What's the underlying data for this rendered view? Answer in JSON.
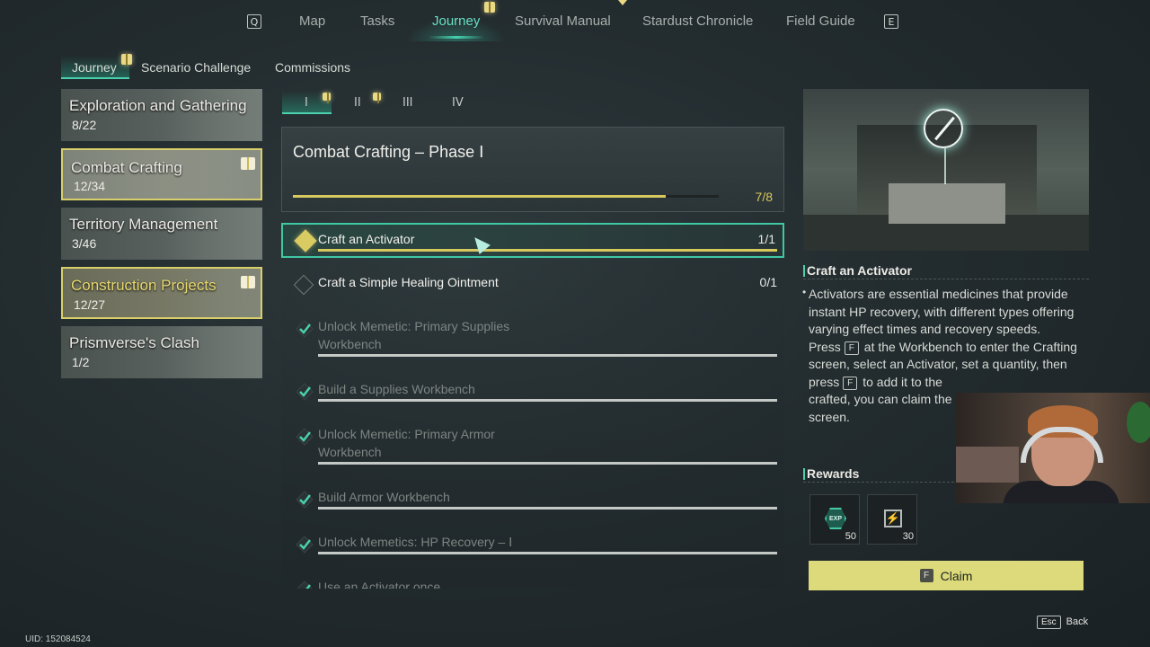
{
  "nav": {
    "left_key": "Q",
    "right_key": "E",
    "tabs": [
      "Map",
      "Tasks",
      "Journey",
      "Survival Manual",
      "Stardust Chronicle",
      "Field Guide"
    ],
    "active_tab": "Journey"
  },
  "subtabs": [
    "Journey",
    "Scenario Challenge",
    "Commissions"
  ],
  "categories": [
    {
      "title": "Exploration and Gathering",
      "count": "8/22"
    },
    {
      "title": "Combat Crafting",
      "count": "12/34"
    },
    {
      "title": "Territory Management",
      "count": "3/46"
    },
    {
      "title": "Construction Projects",
      "count": "12/27"
    },
    {
      "title": "Prismverse's Clash",
      "count": "1/2"
    }
  ],
  "phase_tabs": [
    "I",
    "II",
    "III",
    "IV"
  ],
  "phase": {
    "title": "Combat Crafting – Phase Ⅰ",
    "progress_text": "7/8",
    "progress_fraction": 0.875
  },
  "tasks": [
    {
      "label": "Craft an Activator",
      "count": "1/1",
      "status": "claimable",
      "progress": 1.0
    },
    {
      "label": "Craft a Simple Healing Ointment",
      "count": "0/1",
      "status": "in-progress",
      "progress": 0
    },
    {
      "label": "Unlock Memetic: Primary Supplies Workbench",
      "status": "done",
      "line1": "Unlock Memetic: Primary Supplies",
      "line2": "Workbench"
    },
    {
      "label": "Build a Supplies Workbench",
      "status": "done"
    },
    {
      "label": "Unlock Memetic: Primary Armor Workbench",
      "status": "done",
      "line1": "Unlock Memetic: Primary Armor",
      "line2": "Workbench"
    },
    {
      "label": "Build Armor Workbench",
      "status": "done"
    },
    {
      "label": "Unlock Memetics: HP Recovery – Ⅰ",
      "status": "done"
    },
    {
      "label": "Use an Activator once",
      "status": "done"
    }
  ],
  "detail": {
    "title": "Craft an Activator",
    "desc1": "Activators are essential medicines that provide instant HP recovery, with different types offering varying effect times and recovery speeds.",
    "desc2a": "Press",
    "key": "F",
    "desc2b": "at the Workbench to enter the Crafting screen, select an Activator, set a quantity, then press",
    "desc2c": "to add it to the",
    "desc2d": "crafted, you can claim the",
    "desc2e": "screen.",
    "rewards_heading": "Rewards",
    "rewards": [
      {
        "icon": "exp-icon",
        "icon_text": "EXP",
        "amount": "50"
      },
      {
        "icon": "energy-icon",
        "amount": "30"
      }
    ],
    "claim_key": "F",
    "claim_label": "Claim"
  },
  "footer": {
    "uid": "UID: 152084524",
    "esc_key": "Esc",
    "back_label": "Back"
  },
  "colors": {
    "accent": "#44d2b0",
    "gold": "#d8c95e",
    "claim": "#dcda7a"
  }
}
